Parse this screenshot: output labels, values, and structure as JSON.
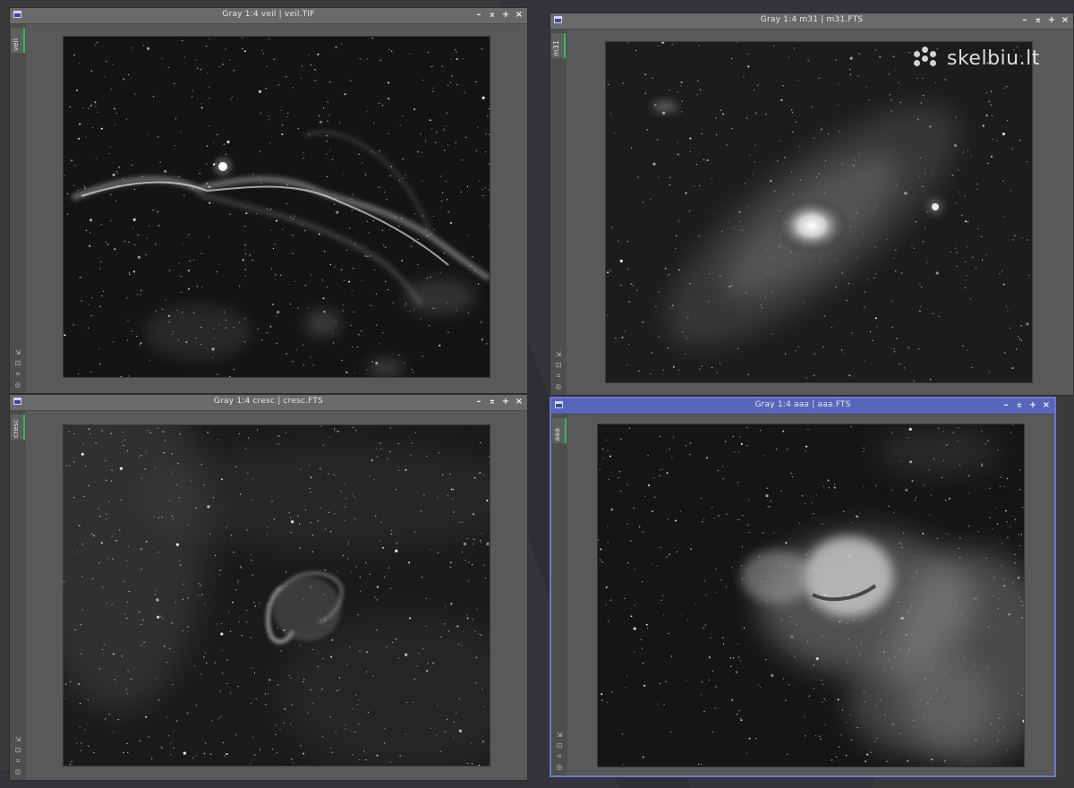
{
  "windows": [
    {
      "id": "veil",
      "title": "Gray 1:4 veil | veil.TIF",
      "tab": "veil",
      "active": false
    },
    {
      "id": "m31",
      "title": "Gray 1:4 m31 | m31.FTS",
      "tab": "m31",
      "active": false
    },
    {
      "id": "cresc",
      "title": "Gray 1:4 cresc | cresc.FTS",
      "tab": "cresc",
      "active": false
    },
    {
      "id": "aaa",
      "title": "Gray 1:4 aaa | aaa.FTS",
      "tab": "aaa",
      "active": true
    }
  ],
  "titlebar_buttons": {
    "minimize": "–",
    "shade": "⌅",
    "maximize": "+",
    "close": "×"
  },
  "side_icons": [
    "⇲",
    "⊡",
    "⌗",
    "◎"
  ],
  "watermark": {
    "text": "skelbiu.lt"
  },
  "colors": {
    "active_border": "#6d78c8",
    "tab_accent": "#2fbf5a",
    "active_titlebar": "#5566bb"
  }
}
